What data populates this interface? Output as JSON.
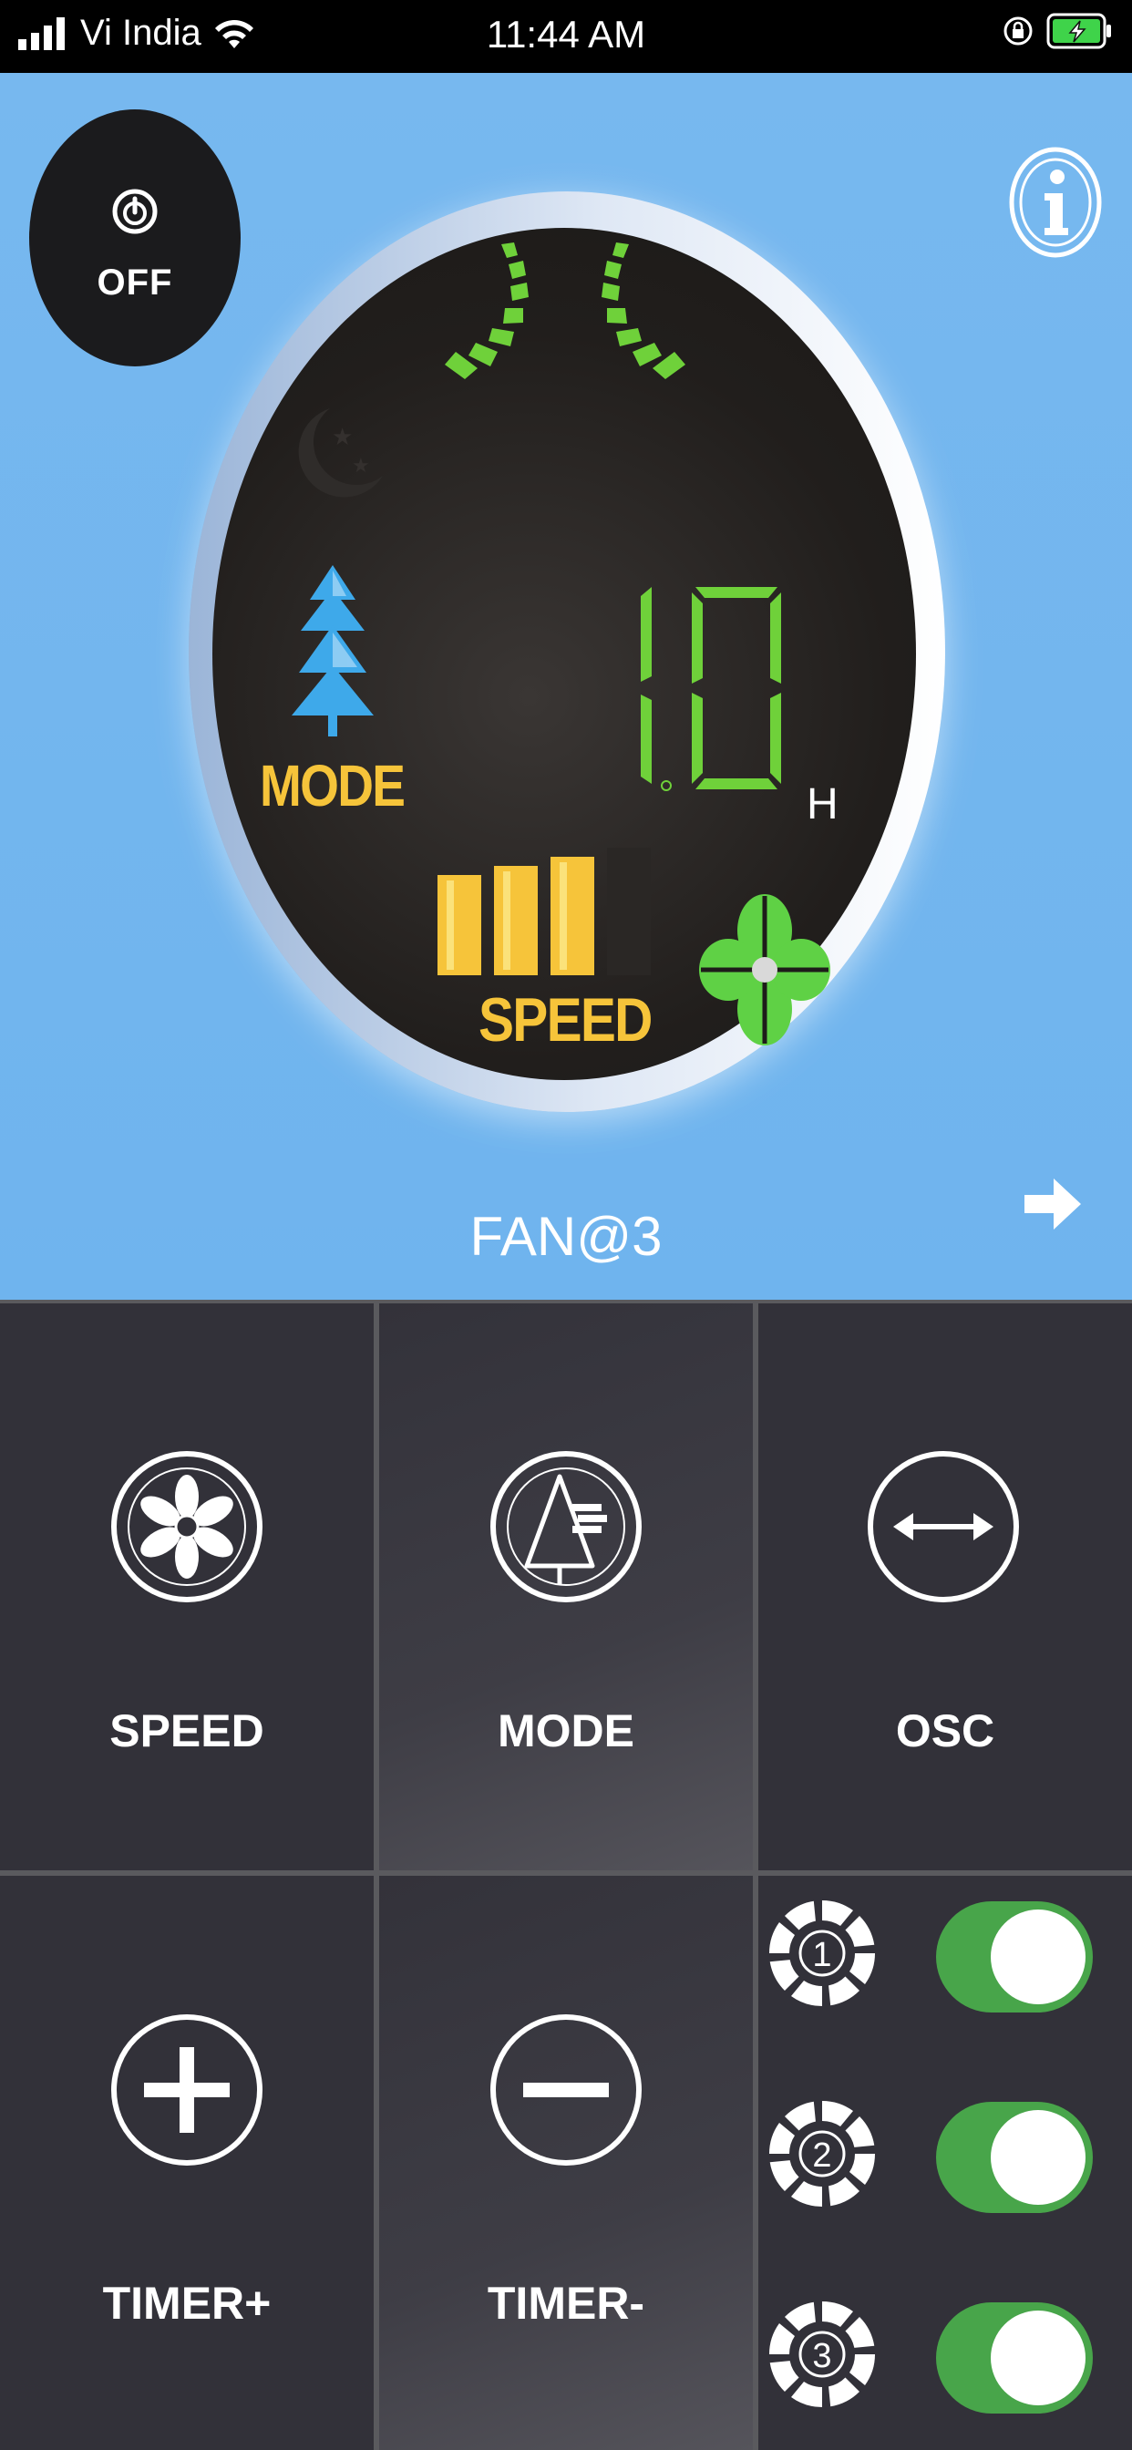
{
  "status_bar": {
    "carrier": "Vi India",
    "time": "11:44 AM",
    "icons": [
      "signal-icon",
      "wifi-icon",
      "orientation-lock-icon",
      "battery-charging-icon"
    ]
  },
  "display": {
    "power_label": "OFF",
    "mode_label": "MODE",
    "speed_label": "SPEED",
    "timer_digits": "10",
    "timer_unit": "H",
    "speed_level": 3,
    "speed_max": 4
  },
  "device_name": "FAN@3",
  "controls": {
    "speed_label": "SPEED",
    "mode_label": "MODE",
    "osc_label": "OSC",
    "timer_plus_label": "TIMER+",
    "timer_minus_label": "TIMER-"
  },
  "fans": [
    {
      "number": "1",
      "on": true
    },
    {
      "number": "2",
      "on": true
    },
    {
      "number": "3",
      "on": true
    }
  ],
  "colors": {
    "background": "#6fb4ee",
    "display": "#211e1c",
    "accent_yellow": "#f6c43a",
    "accent_green": "#6fd13a",
    "toggle_on": "#48a54a",
    "panel": "#323139"
  }
}
